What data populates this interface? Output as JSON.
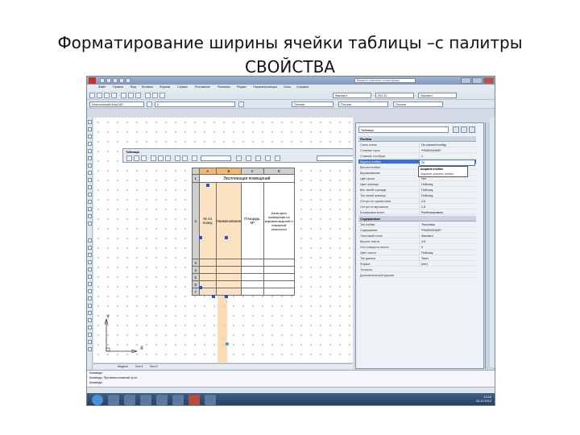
{
  "slide": {
    "title_line1": "Форматирование ширины ячейки таблицы –с палитры",
    "title_line2": "СВОЙСТВА"
  },
  "app": {
    "search_placeholder": "Введите ключевое слово/фразу",
    "menu": [
      "Файл",
      "Правка",
      "Вид",
      "Вставка",
      "Формат",
      "Сервис",
      "Рисование",
      "Размеры",
      "Редакт",
      "Параметризация",
      "Окно",
      "Справка"
    ],
    "workspace": "Классический AutoCAD",
    "layer": "0",
    "linetype_label": "Послою",
    "lineweight_label": "Послою",
    "color_label": "Послою",
    "standard_text": "Standard",
    "standard_dim": "ISO-25"
  },
  "table_toolbar": {
    "label": "Таблица"
  },
  "table": {
    "col_headers": [
      "A",
      "B",
      "C",
      "D"
    ],
    "row_headers": [
      "1",
      "2",
      "3",
      "4",
      "5",
      "6",
      "7"
    ],
    "title": "Экспликация помещений",
    "cells_row2": [
      "№ по плану",
      "Наименование",
      "Площадь, М²",
      "Категория помещения по взрывопожарной и пожарной опасности"
    ]
  },
  "palette": {
    "selection": "Таблица",
    "sections": {
      "cell": "Ячейка",
      "content": "Содержимое"
    },
    "cell_rows": [
      {
        "key": "Стиль ячеек",
        "value": "По строке/столбцу"
      },
      {
        "key": "Слияние строк",
        "value": "*РАЗЛИЧНЫЕ*"
      },
      {
        "key": "Слияние столбцов",
        "value": "1"
      },
      {
        "key": "Ширина ячейки",
        "value": "20"
      },
      {
        "key": "Высота ячейки",
        "value": "*РАЗЛИЧНЫЕ*"
      },
      {
        "key": "Выравнивание",
        "value": "По центру"
      },
      {
        "key": "Цвет фона",
        "value": "Нет"
      },
      {
        "key": "Цвет границы",
        "value": "ПоБлоку"
      },
      {
        "key": "Вес линий границы",
        "value": "ПоБлоку"
      },
      {
        "key": "Тип линий границы",
        "value": "ПоБлоку"
      },
      {
        "key": "Отступ по горизонтали",
        "value": "1.5"
      },
      {
        "key": "Отступ по вертикали",
        "value": "1.5"
      },
      {
        "key": "Блокировка ячеек",
        "value": "Разблокировано"
      },
      {
        "key": "Тип данных ячеек",
        "value": "Общий"
      }
    ],
    "popup": [
      "Ширина ячейки",
      "Задание ширины ячейки"
    ],
    "content_rows": [
      {
        "key": "Тип ячейки",
        "value": "Текстовая"
      },
      {
        "key": "Содержимое",
        "value": "*РАЗЛИЧНЫЕ*"
      },
      {
        "key": "Текстовый стиль",
        "value": "Standard"
      },
      {
        "key": "Высота текста",
        "value": "4.5"
      },
      {
        "key": "Угол поворота текста",
        "value": "0"
      },
      {
        "key": "Цвет текста",
        "value": "ПоБлоку"
      },
      {
        "key": "Тип данных",
        "value": "Текст"
      },
      {
        "key": "Формат",
        "value": "(нет)"
      },
      {
        "key": "Точность",
        "value": ""
      },
      {
        "key": "Дополнительный формат",
        "value": ""
      }
    ]
  },
  "model_tabs": [
    "Модель",
    "Лист1",
    "Лист2"
  ],
  "ucs": {
    "x": "X",
    "y": "Y"
  },
  "command_line": {
    "line1": "Команда:",
    "line2": "Команда: Противоположный угол:",
    "line3": "Команда:"
  },
  "taskbar": {
    "time": "13:16",
    "date": "03.12.2012"
  },
  "colors": {
    "selection": "#3d6fd1",
    "grip": "#1f54c8",
    "column_highlight": "#f7c98d",
    "title_bar": "#8ea5c7"
  }
}
